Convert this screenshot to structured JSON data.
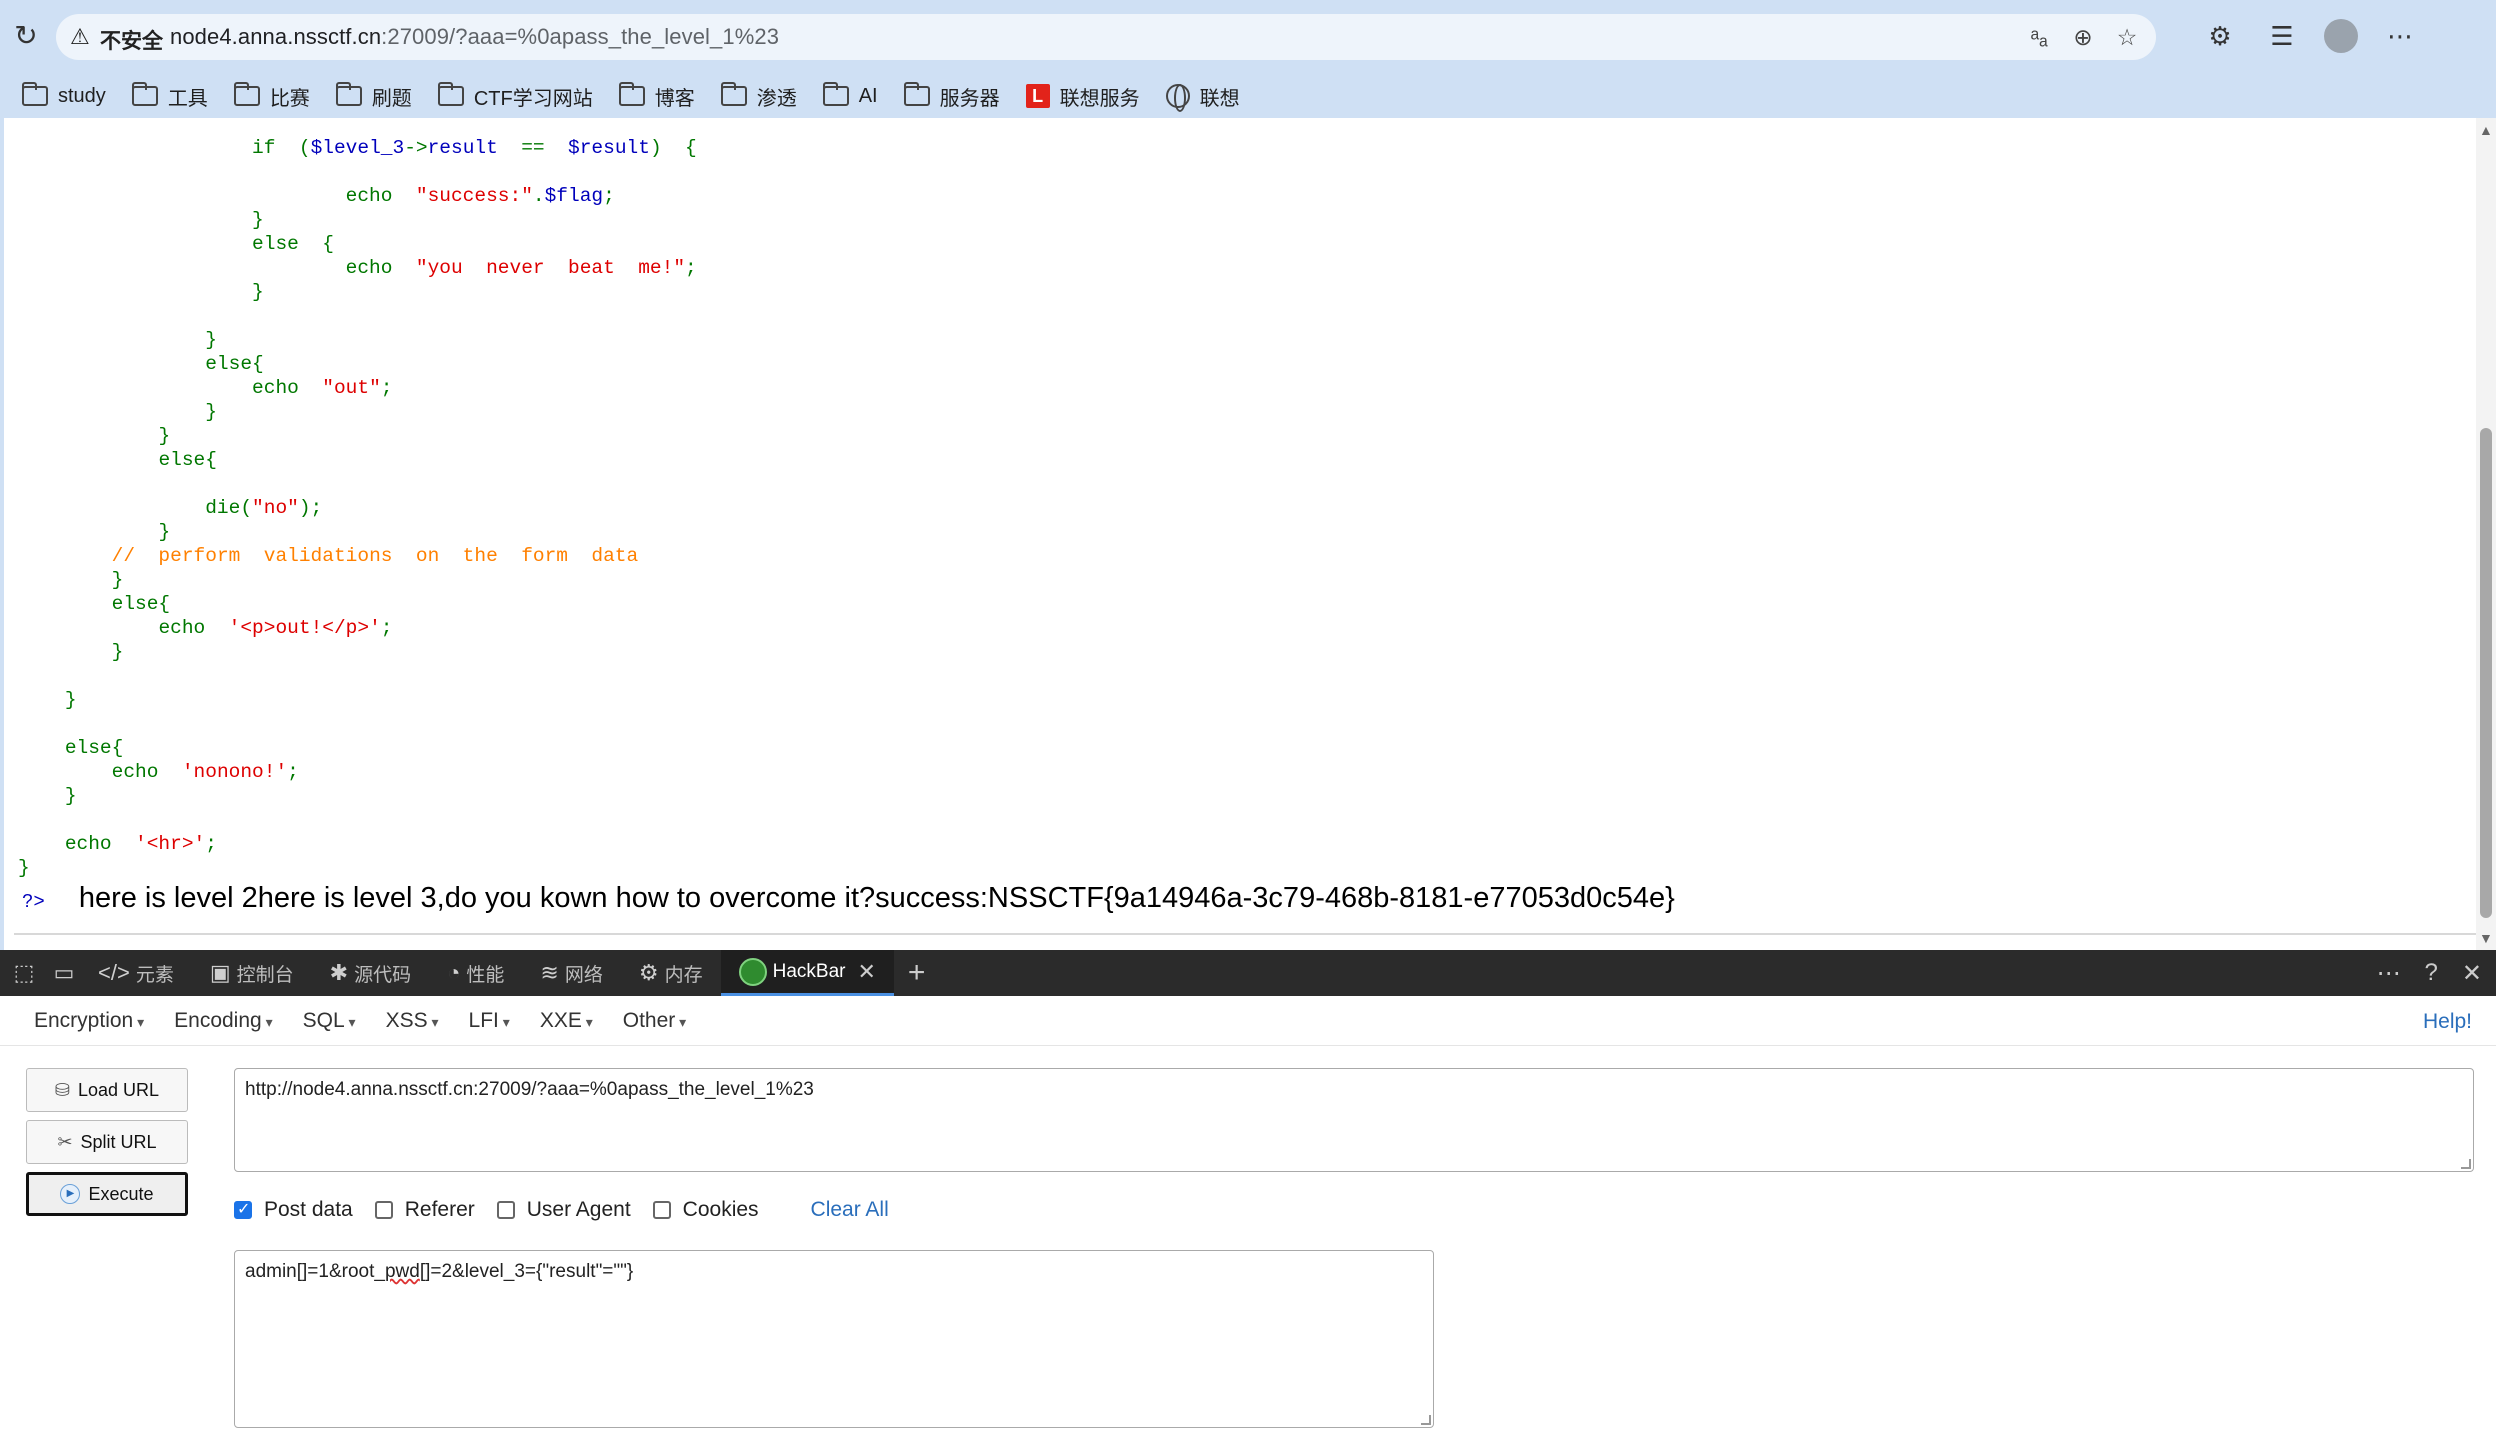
{
  "browser": {
    "insecure_label": "不安全",
    "url_host": "node4.anna.nssctf.cn",
    "url_rest": ":27009/?aaa=%0apass_the_level_1%23",
    "bookmarks": [
      "study",
      "工具",
      "比赛",
      "刷题",
      "CTF学习网站",
      "博客",
      "渗透",
      "AI",
      "服务器",
      "联想服务",
      "联想"
    ]
  },
  "code_lines": [
    {
      "i": 10,
      "p": [
        [
          "kw",
          "if  ("
        ],
        [
          "var",
          "$level_3"
        ],
        [
          "kw",
          "->"
        ],
        [
          "var",
          "result  "
        ],
        [
          "kw",
          "==  "
        ],
        [
          "var",
          "$result"
        ],
        [
          "kw",
          ")  {"
        ]
      ]
    },
    {
      "i": 0,
      "p": []
    },
    {
      "i": 14,
      "p": [
        [
          "kw",
          "echo  "
        ],
        [
          "str",
          "\"success:\""
        ],
        [
          "kw",
          "."
        ],
        [
          "var",
          "$flag"
        ],
        [
          "kw",
          ";"
        ]
      ]
    },
    {
      "i": 10,
      "p": [
        [
          "kw",
          "}"
        ]
      ]
    },
    {
      "i": 10,
      "p": [
        [
          "kw",
          "else  {"
        ]
      ]
    },
    {
      "i": 14,
      "p": [
        [
          "kw",
          "echo  "
        ],
        [
          "str",
          "\"you  never  beat  me!\""
        ],
        [
          "kw",
          ";"
        ]
      ]
    },
    {
      "i": 10,
      "p": [
        [
          "kw",
          "}"
        ]
      ]
    },
    {
      "i": 0,
      "p": []
    },
    {
      "i": 8,
      "p": [
        [
          "kw",
          "}"
        ]
      ]
    },
    {
      "i": 8,
      "p": [
        [
          "kw",
          "else{"
        ]
      ]
    },
    {
      "i": 10,
      "p": [
        [
          "kw",
          "echo  "
        ],
        [
          "str",
          "\"out\""
        ],
        [
          "kw",
          ";"
        ]
      ]
    },
    {
      "i": 8,
      "p": [
        [
          "kw",
          "}"
        ]
      ]
    },
    {
      "i": 6,
      "p": [
        [
          "kw",
          "}"
        ]
      ]
    },
    {
      "i": 6,
      "p": [
        [
          "kw",
          "else{"
        ]
      ]
    },
    {
      "i": 0,
      "p": []
    },
    {
      "i": 8,
      "p": [
        [
          "kw",
          "die("
        ],
        [
          "str",
          "\"no\""
        ],
        [
          "kw",
          ");"
        ]
      ]
    },
    {
      "i": 6,
      "p": [
        [
          "kw",
          "}"
        ]
      ]
    },
    {
      "i": 4,
      "p": [
        [
          "cm",
          "//  perform  validations  on  the  form  data"
        ]
      ]
    },
    {
      "i": 4,
      "p": [
        [
          "kw",
          "}"
        ]
      ]
    },
    {
      "i": 4,
      "p": [
        [
          "kw",
          "else{"
        ]
      ]
    },
    {
      "i": 6,
      "p": [
        [
          "kw",
          "echo  "
        ],
        [
          "str",
          "'<p>out!</p>'"
        ],
        [
          "kw",
          ";"
        ]
      ]
    },
    {
      "i": 4,
      "p": [
        [
          "kw",
          "}"
        ]
      ]
    },
    {
      "i": 0,
      "p": []
    },
    {
      "i": 2,
      "p": [
        [
          "kw",
          "}"
        ]
      ]
    },
    {
      "i": 0,
      "p": []
    },
    {
      "i": 2,
      "p": [
        [
          "kw",
          "else{"
        ]
      ]
    },
    {
      "i": 4,
      "p": [
        [
          "kw",
          "echo  "
        ],
        [
          "str",
          "'nonono!'"
        ],
        [
          "kw",
          ";"
        ]
      ]
    },
    {
      "i": 2,
      "p": [
        [
          "kw",
          "}"
        ]
      ]
    },
    {
      "i": 0,
      "p": []
    },
    {
      "i": 2,
      "p": [
        [
          "kw",
          "echo  "
        ],
        [
          "str",
          "'<hr>'"
        ],
        [
          "kw",
          ";"
        ]
      ]
    },
    {
      "i": 0,
      "p": [
        [
          "kw",
          "}"
        ]
      ]
    }
  ],
  "php_close": "?>",
  "output_text": "here is level 2here is level 3,do you kown how to overcome it?success:NSSCTF{9a14946a-3c79-468b-8181-e77053d0c54e}",
  "devtools": {
    "tabs": [
      "元素",
      "控制台",
      "源代码",
      "性能",
      "网络",
      "内存",
      "HackBar"
    ]
  },
  "hackbar": {
    "menus": [
      "Encryption",
      "Encoding",
      "SQL",
      "XSS",
      "LFI",
      "XXE",
      "Other"
    ],
    "help": "Help!",
    "load_url": "Load URL",
    "split_url": "Split URL",
    "execute": "Execute",
    "url_value": "http://node4.anna.nssctf.cn:27009/?aaa=%0apass_the_level_1%23",
    "checks": [
      {
        "label": "Post data",
        "checked": true
      },
      {
        "label": "Referer",
        "checked": false
      },
      {
        "label": "User Agent",
        "checked": false
      },
      {
        "label": "Cookies",
        "checked": false
      }
    ],
    "clear_all": "Clear All",
    "post_pre": "admin[]=1&root_",
    "post_squig": "pwd",
    "post_post": "[]=2&level_3={\"result\"=\"\"}"
  }
}
